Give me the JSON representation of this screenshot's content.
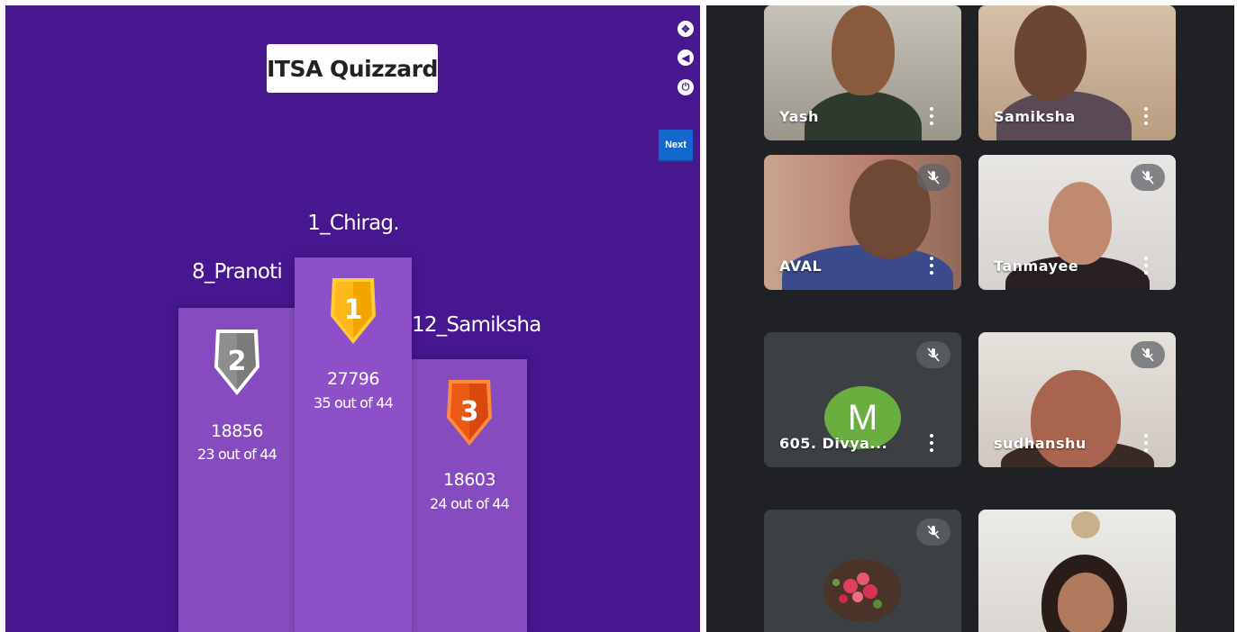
{
  "quiz": {
    "title": "ITSA Quizzard",
    "next_label": "Next",
    "colors": {
      "background": "#46178f",
      "podium": "#864cbf",
      "gold": "#ffa602",
      "silver": "#8a8a8a",
      "bronze": "#ea5a14"
    },
    "podium": [
      {
        "rank": "2",
        "name": "8_Pranoti",
        "score": "18856",
        "correct": "23 out of 44"
      },
      {
        "rank": "1",
        "name": "1_Chirag.",
        "score": "27796",
        "correct": "35 out of 44"
      },
      {
        "rank": "3",
        "name": "12_Samiksha",
        "score": "18603",
        "correct": "24 out of 44"
      }
    ],
    "controls": [
      "fullscreen-icon",
      "volume-icon",
      "power-icon"
    ]
  },
  "meet": {
    "participants": [
      {
        "name": "Yash",
        "muted": false
      },
      {
        "name": "Samiksha",
        "muted": true
      },
      {
        "name": "AVAL",
        "muted": true
      },
      {
        "name": "Tanmayee",
        "muted": true
      },
      {
        "name": "605. Divya...",
        "muted": true,
        "avatar_letter": "M"
      },
      {
        "name": "sudhanshu",
        "muted": true
      },
      {
        "name": "",
        "muted": true
      },
      {
        "name": "",
        "muted": false
      }
    ]
  }
}
